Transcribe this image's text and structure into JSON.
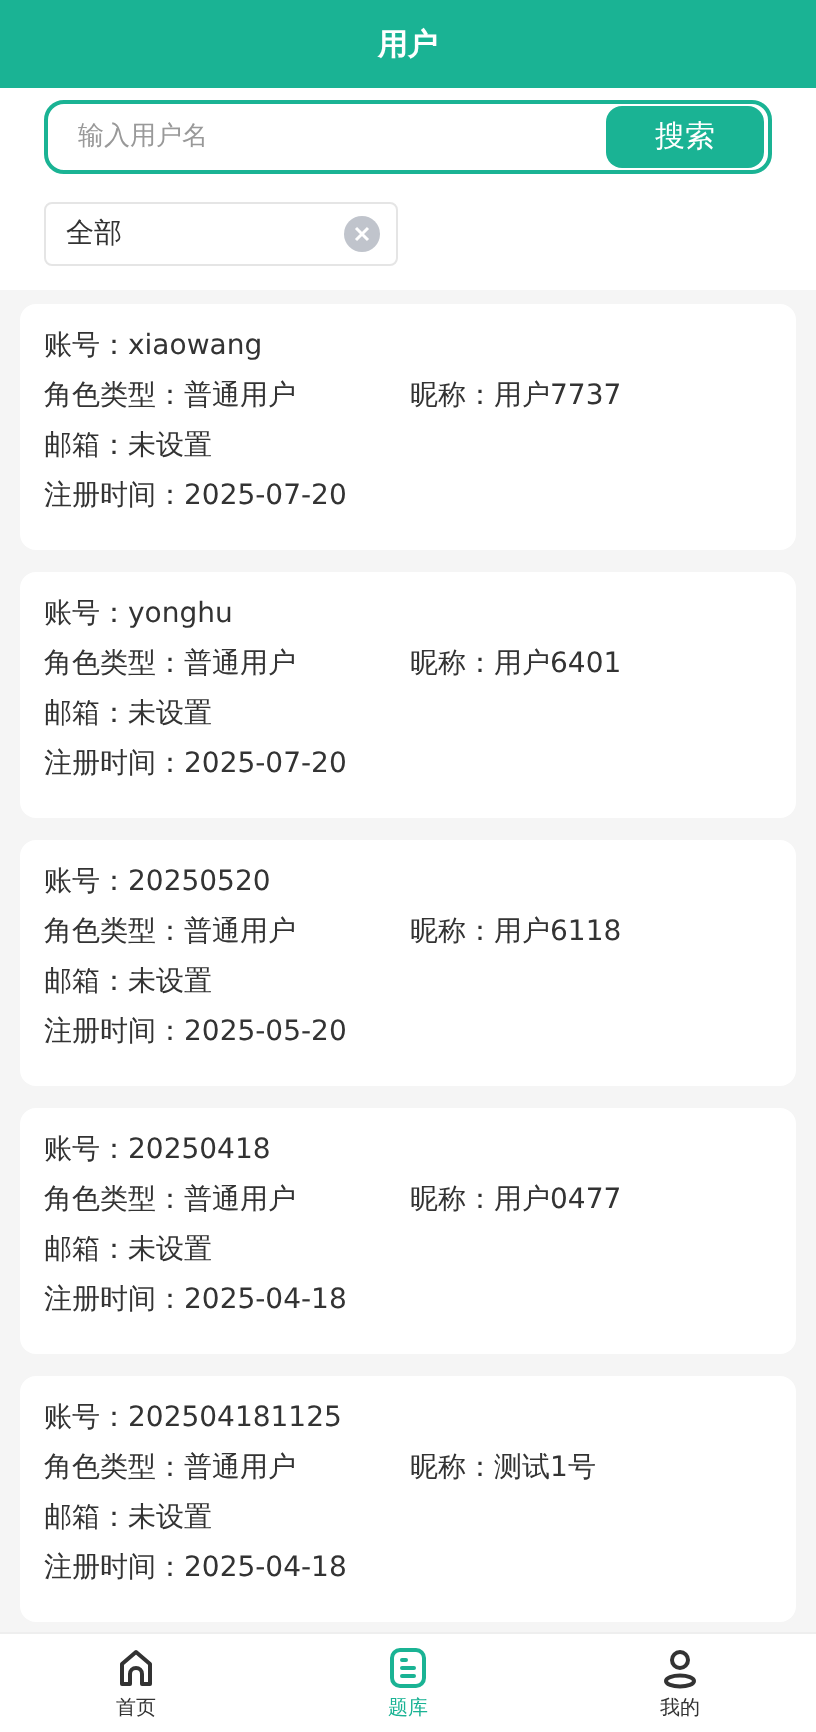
{
  "header": {
    "title": "用户"
  },
  "search": {
    "placeholder": "输入用户名",
    "button": "搜索"
  },
  "filter": {
    "value": "全部"
  },
  "users": [
    {
      "account": "账号：xiaowang",
      "role": "角色类型：普通用户",
      "nickname": "昵称：用户7737",
      "email": "邮箱：未设置",
      "registered": "注册时间：2025-07-20"
    },
    {
      "account": "账号：yonghu",
      "role": "角色类型：普通用户",
      "nickname": "昵称：用户6401",
      "email": "邮箱：未设置",
      "registered": "注册时间：2025-07-20"
    },
    {
      "account": "账号：20250520",
      "role": "角色类型：普通用户",
      "nickname": "昵称：用户6118",
      "email": "邮箱：未设置",
      "registered": "注册时间：2025-05-20"
    },
    {
      "account": "账号：20250418",
      "role": "角色类型：普通用户",
      "nickname": "昵称：用户0477",
      "email": "邮箱：未设置",
      "registered": "注册时间：2025-04-18"
    },
    {
      "account": "账号：202504181125",
      "role": "角色类型：普通用户",
      "nickname": "昵称：测试1号",
      "email": "邮箱：未设置",
      "registered": "注册时间：2025-04-18"
    }
  ],
  "tabs": [
    {
      "kind": "home",
      "label": "首页",
      "selected": false
    },
    {
      "kind": "bank",
      "label": "题库",
      "selected": true
    },
    {
      "kind": "me",
      "label": "我的",
      "selected": false
    }
  ]
}
